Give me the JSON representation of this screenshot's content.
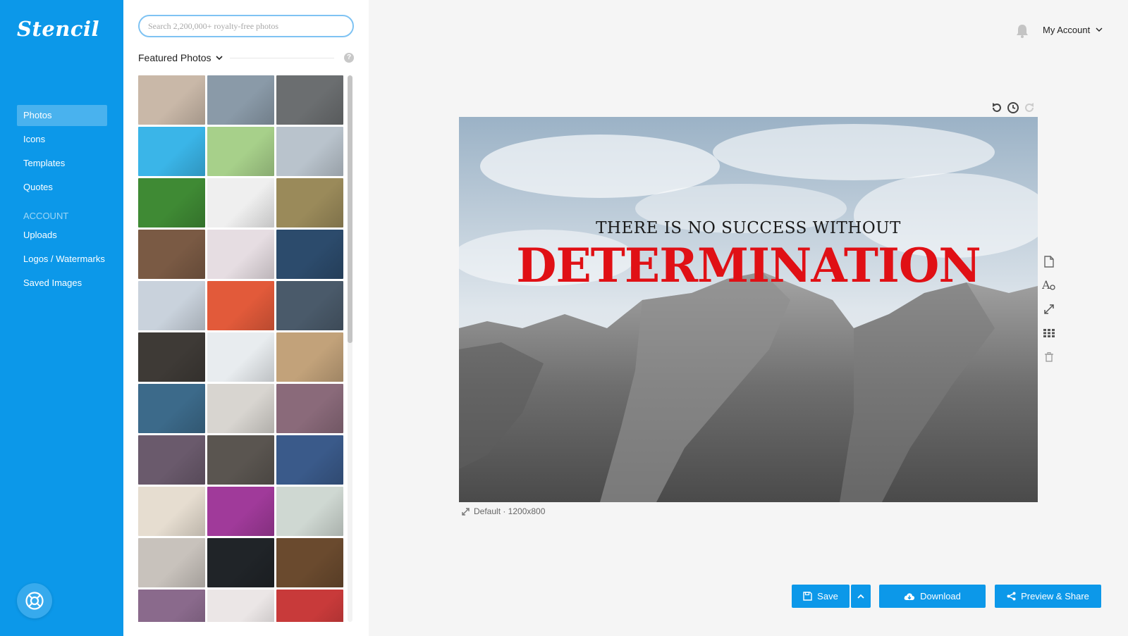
{
  "app": {
    "logo": "Stencil"
  },
  "sidebar": {
    "items": [
      {
        "label": "Photos",
        "active": true
      },
      {
        "label": "Icons"
      },
      {
        "label": "Templates"
      },
      {
        "label": "Quotes"
      }
    ],
    "section_label": "ACCOUNT",
    "account_items": [
      {
        "label": "Uploads"
      },
      {
        "label": "Logos / Watermarks"
      },
      {
        "label": "Saved Images"
      }
    ]
  },
  "panel": {
    "search_placeholder": "Search 2,200,000+ royalty-free photos",
    "title": "Featured Photos",
    "help_glyph": "?",
    "thumbnails": [
      "#c9b8a8",
      "#8a9aa8",
      "#6b6e70",
      "#3ab5e8",
      "#a7d08a",
      "#b9c3cc",
      "#3f8a34",
      "#efefef",
      "#9a8a5a",
      "#7a5a44",
      "#e6dde2",
      "#2c4b6c",
      "#c9d2dc",
      "#e25a3a",
      "#4a5a6a",
      "#3e3a36",
      "#e8ecef",
      "#c2a27a",
      "#3c6a8a",
      "#d8d5d0",
      "#8a6a7a",
      "#6a5a6c",
      "#5a5550",
      "#3a5a8a",
      "#e6ddd0",
      "#a03a9a",
      "#cfd8d2",
      "#c8c2bc",
      "#202428",
      "#6a4a2e",
      "#8a6a8c",
      "#ebe6e6",
      "#c83a3a"
    ]
  },
  "header": {
    "account_label": "My Account"
  },
  "canvas": {
    "quote_line1": "THERE IS NO SUCCESS WITHOUT",
    "quote_line2": "DETERMINATION",
    "quote_color": "#e01015",
    "size_label": "Default · 1200x800"
  },
  "icons": {
    "bell": "bell-icon",
    "undo": "undo-icon",
    "history": "history-icon",
    "redo": "redo-icon",
    "page": "page-icon",
    "text": "text-style-icon",
    "resize": "resize-icon",
    "grid": "grid-icon",
    "trash": "trash-icon",
    "help": "lifebuoy-icon"
  },
  "actions": {
    "save": "Save",
    "download": "Download",
    "share": "Preview & Share"
  },
  "colors": {
    "brand": "#0c98e9",
    "accent_red": "#e01015"
  }
}
